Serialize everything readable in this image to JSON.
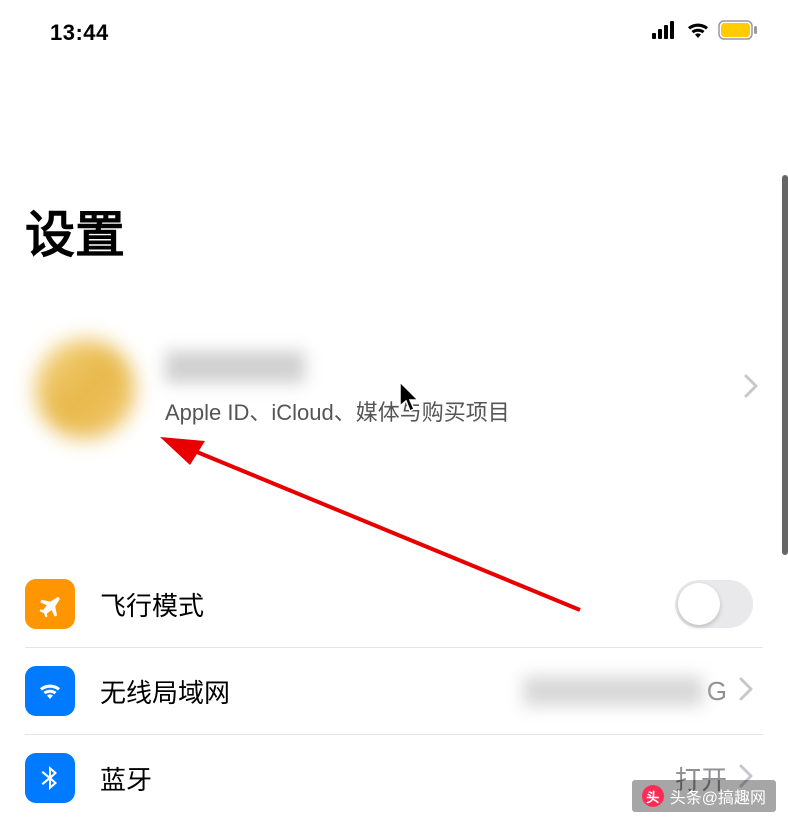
{
  "status_bar": {
    "time": "13:44"
  },
  "page": {
    "title": "设置"
  },
  "profile": {
    "subtitle": "Apple ID、iCloud、媒体与购买项目"
  },
  "rows": {
    "airplane": {
      "label": "飞行模式",
      "toggled": false
    },
    "wifi": {
      "label": "无线局域网",
      "value_suffix": "G"
    },
    "bluetooth": {
      "label": "蓝牙",
      "value": "打开"
    }
  },
  "watermark": {
    "label": "头条@搞趣网"
  }
}
